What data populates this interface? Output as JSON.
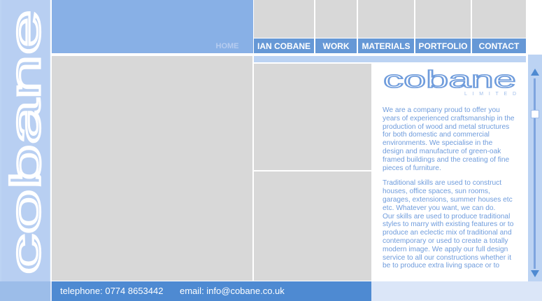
{
  "brand": {
    "vertical_wordmark": "cobane",
    "logo_wordmark": "cobane",
    "logo_subtitle": "LIMITED"
  },
  "nav": {
    "home": "HOME",
    "items": [
      {
        "label": "IAN COBANE"
      },
      {
        "label": "WORK"
      },
      {
        "label": "MATERIALS"
      },
      {
        "label": "PORTFOLIO"
      },
      {
        "label": "CONTACT"
      }
    ]
  },
  "content": {
    "paragraph1": "We are a company proud to offer you years of experienced craftsmanship in the production of wood and metal structures for both domestic and commercial environments. We specialise in the design and manufacture of green-oak framed buildings and the creating of fine pieces of furniture.",
    "paragraph2": "Traditional skills are used to construct houses, office spaces, sun rooms, garages, extensions, summer houses etc etc. Whatever you want, we can do.",
    "paragraph3": "Our skills are used to produce traditional styles to marry with existing features or to produce an eclectic mix of traditional and contemporary or used to create a totally modern image. We apply our full design service to all our constructions whether it be to produce extra living space or to"
  },
  "footer": {
    "telephone": "telephone: 0774 8653442",
    "email": "email: info@cobane.co.uk"
  },
  "icons": {
    "scroll_up": "triangle-up-icon",
    "scroll_down": "triangle-down-icon"
  },
  "colors": {
    "accent_blue": "#6698d6",
    "light_blue": "#bcd3f3",
    "text_blue": "#6f9cdc",
    "footer_blue": "#4e8ad2",
    "placeholder_gray": "#d8d8d8"
  }
}
